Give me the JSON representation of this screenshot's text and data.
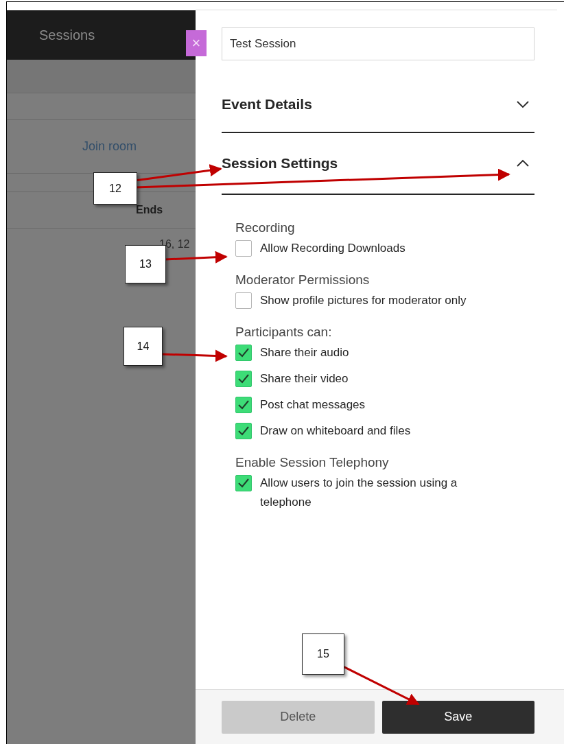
{
  "sidebar": {
    "title": "Sessions",
    "link": "Join room",
    "column_heading": "Ends",
    "cell": "16, 12"
  },
  "close_button": {
    "label": "×"
  },
  "session_name": {
    "value": "Test Session"
  },
  "sections": [
    {
      "title": "Event Details",
      "expanded": false
    },
    {
      "title": "Session Settings",
      "expanded": true
    }
  ],
  "settings_groups": [
    {
      "heading": "Recording",
      "options": [
        {
          "label": "Allow Recording Downloads",
          "checked": false
        }
      ]
    },
    {
      "heading": "Moderator Permissions",
      "options": [
        {
          "label": "Show profile pictures for moderator only",
          "checked": false
        }
      ]
    },
    {
      "heading": "Participants can:",
      "options": [
        {
          "label": "Share their audio",
          "checked": true
        },
        {
          "label": "Share their video",
          "checked": true
        },
        {
          "label": "Post chat messages",
          "checked": true
        },
        {
          "label": "Draw on whiteboard and files",
          "checked": true
        }
      ]
    },
    {
      "heading": "Enable Session Telephony",
      "options": [
        {
          "label": "Allow users to join the session using a telephone",
          "checked": true
        }
      ]
    }
  ],
  "footer": {
    "buttons": [
      {
        "label": "Delete",
        "kind": "secondary"
      },
      {
        "label": "Save",
        "kind": "primary"
      }
    ]
  },
  "annotations": [
    {
      "label": "12"
    },
    {
      "label": "13"
    },
    {
      "label": "14"
    },
    {
      "label": "15"
    }
  ]
}
